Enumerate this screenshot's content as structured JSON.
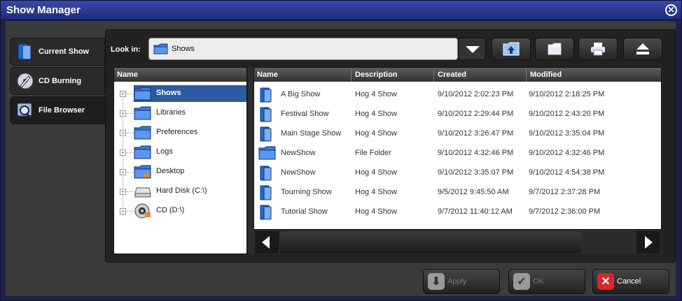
{
  "window": {
    "title": "Show Manager"
  },
  "tabs": [
    {
      "label": "Current Show",
      "icon": "show-book-icon"
    },
    {
      "label": "CD Burning",
      "icon": "cd-burn-icon"
    },
    {
      "label": "File Browser",
      "icon": "file-browser-icon"
    }
  ],
  "lookin": {
    "label": "Look in:",
    "value": "Shows"
  },
  "toolbar": {
    "buttons": [
      {
        "name": "up-folder-button",
        "icon": "folder-up-icon"
      },
      {
        "name": "new-folder-button",
        "icon": "new-folder-icon"
      },
      {
        "name": "print-button",
        "icon": "printer-icon"
      },
      {
        "name": "eject-button",
        "icon": "eject-icon"
      }
    ]
  },
  "tree": {
    "header": "Name",
    "items": [
      {
        "label": "Shows",
        "selected": true,
        "icon": "folder-icon"
      },
      {
        "label": "Libraries",
        "icon": "folder-icon"
      },
      {
        "label": "Preferences",
        "icon": "folder-icon"
      },
      {
        "label": "Logs",
        "icon": "folder-icon"
      },
      {
        "label": "Desktop",
        "icon": "desktop-folder-icon"
      },
      {
        "label": "Hard Disk (C:\\)",
        "icon": "hard-disk-icon"
      },
      {
        "label": "CD (D:\\)",
        "icon": "cd-drive-icon"
      }
    ]
  },
  "list": {
    "columns": [
      "Name",
      "Description",
      "Created",
      "Modified"
    ],
    "rows": [
      {
        "icon": "show-book-icon",
        "name": "A Big Show",
        "description": "Hog 4 Show",
        "created": "9/10/2012 2:02:23 PM",
        "modified": "9/10/2012 2:18:25 PM"
      },
      {
        "icon": "show-book-icon",
        "name": "Festival Show",
        "description": "Hog 4 Show",
        "created": "9/10/2012 2:29:44 PM",
        "modified": "9/10/2012 2:43:20 PM"
      },
      {
        "icon": "show-book-icon",
        "name": "Main Stage Show",
        "description": "Hog 4 Show",
        "created": "9/10/2012 3:26:47 PM",
        "modified": "9/10/2012 3:35:04 PM"
      },
      {
        "icon": "folder-icon",
        "name": "NewShow",
        "description": "File Folder",
        "created": "9/10/2012 4:32:46 PM",
        "modified": "9/10/2012 4:32:46 PM"
      },
      {
        "icon": "show-book-icon",
        "name": "NewShow",
        "description": "Hog 4 Show",
        "created": "9/10/2012 3:35:07 PM",
        "modified": "9/10/2012 4:54:38 PM"
      },
      {
        "icon": "show-book-icon",
        "name": "Tourning Show",
        "description": "Hog 4 Show",
        "created": "9/5/2012 9:45:50 AM",
        "modified": "9/7/2012 2:37:28 PM"
      },
      {
        "icon": "show-book-icon",
        "name": "Tutorial Show",
        "description": "Hog 4 Show",
        "created": "9/7/2012 11:40:12 AM",
        "modified": "9/7/2012 2:36:00 PM"
      }
    ]
  },
  "buttons": {
    "apply": "Apply",
    "ok": "OK",
    "cancel": "Cancel"
  },
  "colors": {
    "titlebar": "#2a349a",
    "selection": "#2e5aa0",
    "folder": "#3a7be0",
    "cancel": "#d8262a"
  }
}
